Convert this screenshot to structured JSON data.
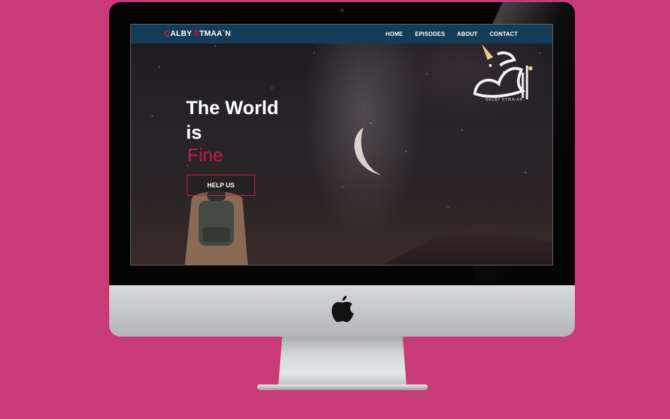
{
  "nav": {
    "brand_part1": "Q",
    "brand_part2": "ALBY ",
    "brand_part3": "E",
    "brand_part4": "TMAA`N",
    "links": [
      "HOME",
      "EPISODES",
      "ABOUT",
      "CONTACT"
    ]
  },
  "hero": {
    "line1": "The World",
    "line2": "is",
    "accent": "Fine",
    "button": "HELP US"
  },
  "logo": {
    "subtitle": "QALBY ETMA'AN"
  },
  "colors": {
    "background": "#c93a78",
    "navbar": "#143b57",
    "accent": "#c8194a"
  },
  "icons": [
    "apple-icon",
    "moon-icon",
    "calligraphy-logo-icon"
  ]
}
